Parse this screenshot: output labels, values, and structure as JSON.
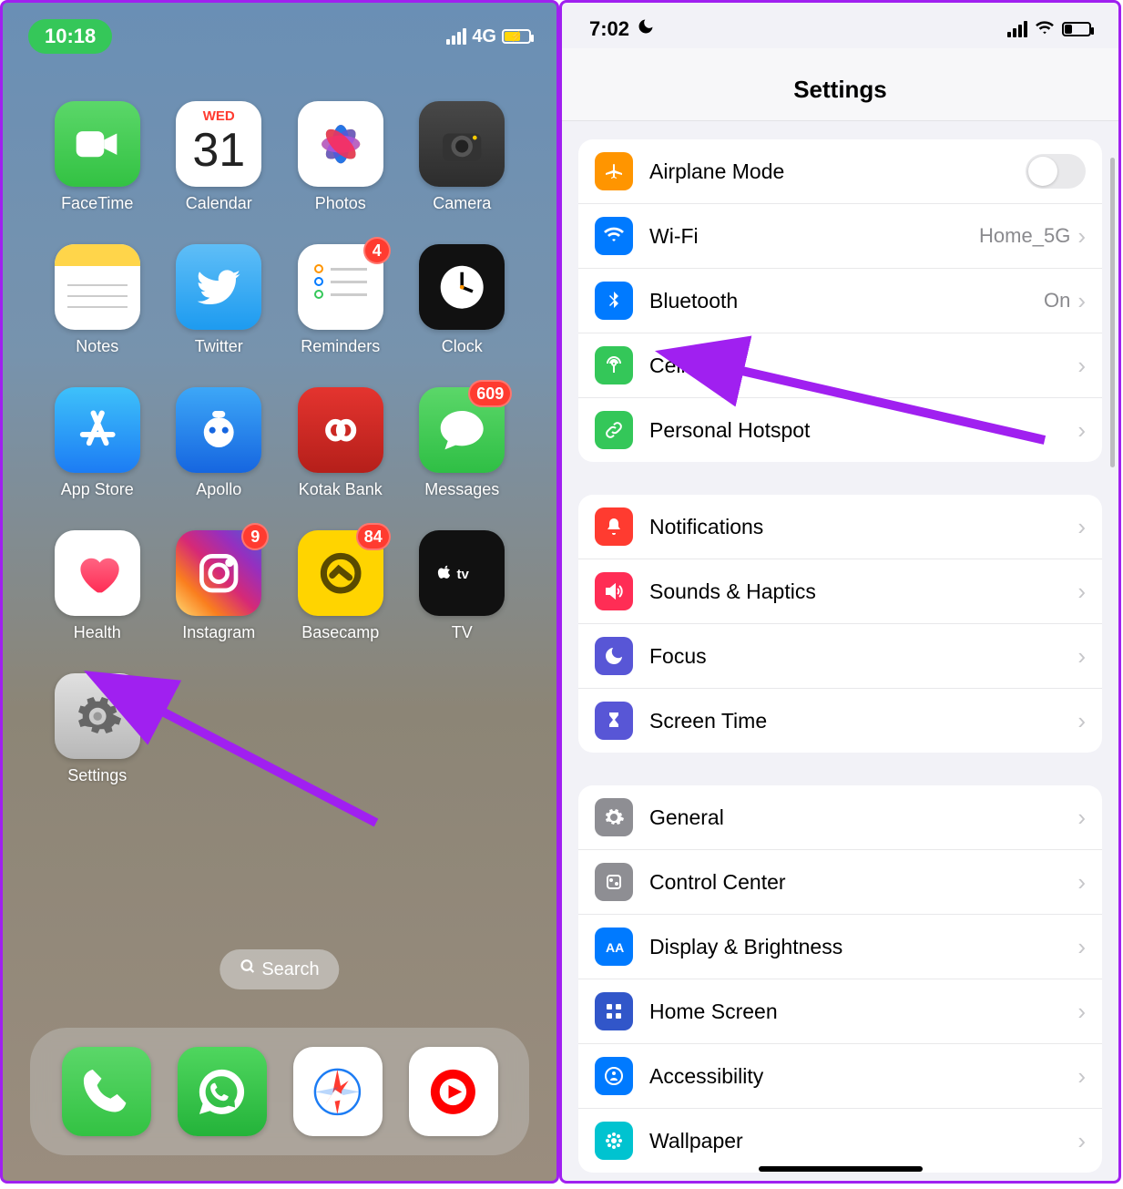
{
  "left": {
    "status": {
      "time": "10:18",
      "network": "4G"
    },
    "apps": [
      {
        "name": "facetime",
        "label": "FaceTime",
        "icon": "video-icon"
      },
      {
        "name": "calendar",
        "label": "Calendar",
        "icon": "calendar-icon",
        "day": "WED",
        "date": "31"
      },
      {
        "name": "photos",
        "label": "Photos",
        "icon": "flower-icon"
      },
      {
        "name": "camera",
        "label": "Camera",
        "icon": "camera-icon"
      },
      {
        "name": "notes",
        "label": "Notes",
        "icon": "notes-icon"
      },
      {
        "name": "twitter",
        "label": "Twitter",
        "icon": "bird-icon"
      },
      {
        "name": "reminders",
        "label": "Reminders",
        "icon": "list-icon",
        "badge": "4"
      },
      {
        "name": "clock",
        "label": "Clock",
        "icon": "clock-icon"
      },
      {
        "name": "appstore",
        "label": "App Store",
        "icon": "a-icon"
      },
      {
        "name": "apollo",
        "label": "Apollo",
        "icon": "robot-icon"
      },
      {
        "name": "kotak",
        "label": "Kotak Bank",
        "icon": "infinity-icon"
      },
      {
        "name": "messages",
        "label": "Messages",
        "icon": "bubble-icon",
        "badge": "609"
      },
      {
        "name": "health",
        "label": "Health",
        "icon": "heart-icon"
      },
      {
        "name": "instagram",
        "label": "Instagram",
        "icon": "instagram-icon",
        "badge": "9"
      },
      {
        "name": "basecamp",
        "label": "Basecamp",
        "icon": "chart-icon",
        "badge": "84"
      },
      {
        "name": "tv",
        "label": "TV",
        "icon": "appletv-icon"
      },
      {
        "name": "settings",
        "label": "Settings",
        "icon": "gear-icon"
      }
    ],
    "search": "Search",
    "dock": [
      {
        "name": "phone",
        "icon": "phone-icon"
      },
      {
        "name": "whatsapp",
        "icon": "whatsapp-icon"
      },
      {
        "name": "safari",
        "icon": "compass-icon"
      },
      {
        "name": "ytmusic",
        "icon": "play-circle-icon"
      }
    ]
  },
  "right": {
    "status": {
      "time": "7:02"
    },
    "title": "Settings",
    "groups": [
      [
        {
          "name": "airplane",
          "icon": "plane-icon",
          "label": "Airplane Mode",
          "control": "toggle"
        },
        {
          "name": "wifi",
          "icon": "wifi-icon",
          "label": "Wi-Fi",
          "value": "Home_5G"
        },
        {
          "name": "bluetooth",
          "icon": "bluetooth-icon",
          "label": "Bluetooth",
          "value": "On"
        },
        {
          "name": "cellular",
          "icon": "antenna-icon",
          "label": "Cellular"
        },
        {
          "name": "hotspot",
          "icon": "link-icon",
          "label": "Personal Hotspot"
        }
      ],
      [
        {
          "name": "notifications",
          "icon": "bell-icon",
          "label": "Notifications"
        },
        {
          "name": "sounds",
          "icon": "speaker-icon",
          "label": "Sounds & Haptics"
        },
        {
          "name": "focus",
          "icon": "moon-icon",
          "label": "Focus"
        },
        {
          "name": "screentime",
          "icon": "hourglass-icon",
          "label": "Screen Time"
        }
      ],
      [
        {
          "name": "general",
          "icon": "gear-icon",
          "label": "General"
        },
        {
          "name": "controlcenter",
          "icon": "sliders-icon",
          "label": "Control Center"
        },
        {
          "name": "display",
          "icon": "aa-icon",
          "label": "Display & Brightness"
        },
        {
          "name": "homescreen",
          "icon": "grid-icon",
          "label": "Home Screen"
        },
        {
          "name": "accessibility",
          "icon": "person-icon",
          "label": "Accessibility"
        },
        {
          "name": "wallpaper",
          "icon": "flower2-icon",
          "label": "Wallpaper"
        }
      ]
    ]
  }
}
